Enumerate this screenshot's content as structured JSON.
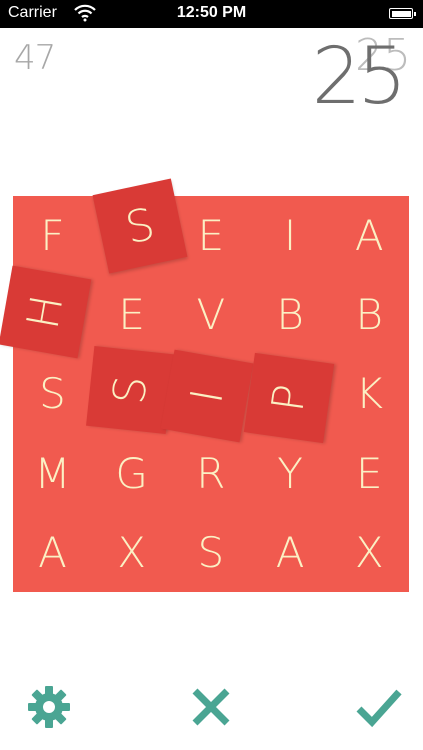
{
  "status_bar": {
    "carrier": "Carrier",
    "time": "12:50 PM",
    "icons": [
      "wifi-icon",
      "battery-icon"
    ]
  },
  "game": {
    "score": "47",
    "timer": "25",
    "timer_ghost": "25"
  },
  "colors": {
    "board": "#f15a4f",
    "tile_selected": "#d93a36",
    "letter": "#fbf0c4",
    "action_teal": "#4aa593"
  },
  "board": {
    "rows": [
      [
        "F",
        "",
        "E",
        "I",
        "A"
      ],
      [
        "",
        "E",
        "V",
        "B",
        "B"
      ],
      [
        "S",
        "",
        "",
        "",
        "K"
      ],
      [
        "M",
        "G",
        "R",
        "Y",
        "E"
      ],
      [
        "A",
        "X",
        "S",
        "A",
        "X"
      ]
    ]
  },
  "selected_tiles": [
    {
      "letter": "S",
      "row": 0,
      "col": 1
    },
    {
      "letter": "H",
      "row": 1,
      "col": 0
    },
    {
      "letter": "S",
      "row": 2,
      "col": 1
    },
    {
      "letter": "I",
      "row": 2,
      "col": 2
    },
    {
      "letter": "P",
      "row": 2,
      "col": 3
    }
  ],
  "toolbar": {
    "settings_icon": "gear-icon",
    "clear_icon": "x-icon",
    "submit_icon": "checkmark-icon"
  }
}
